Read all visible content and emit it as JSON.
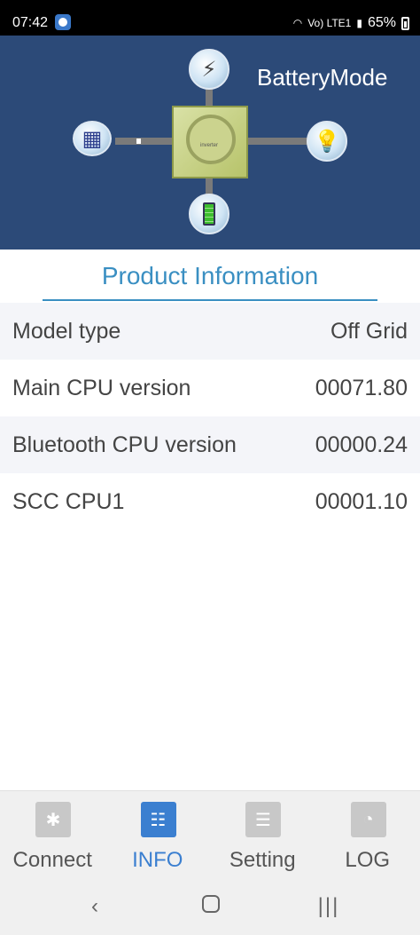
{
  "status_bar": {
    "time": "07:42",
    "battery_percent": "65%",
    "network": "Vo) LTE1"
  },
  "header": {
    "mode_text": "BatteryMode",
    "inverter_label": "inverter",
    "background_color": "#2c4a78"
  },
  "product_info": {
    "title": "Product Information",
    "accent_color": "#3a8fc2",
    "rows": [
      {
        "label": "Model type",
        "value": "Off Grid"
      },
      {
        "label": "Main CPU version",
        "value": "00071.80"
      },
      {
        "label": "Bluetooth CPU version",
        "value": "00000.24"
      },
      {
        "label": "SCC CPU1",
        "value": "00001.10"
      }
    ]
  },
  "tabs": [
    {
      "label": "Connect",
      "icon": "bluetooth-icon",
      "active": false
    },
    {
      "label": "INFO",
      "icon": "info-icon",
      "active": true
    },
    {
      "label": "Setting",
      "icon": "sliders-icon",
      "active": false
    },
    {
      "label": "LOG",
      "icon": "log-icon",
      "active": false
    }
  ],
  "nav_bar": {
    "back": "‹",
    "recents": "|||"
  }
}
